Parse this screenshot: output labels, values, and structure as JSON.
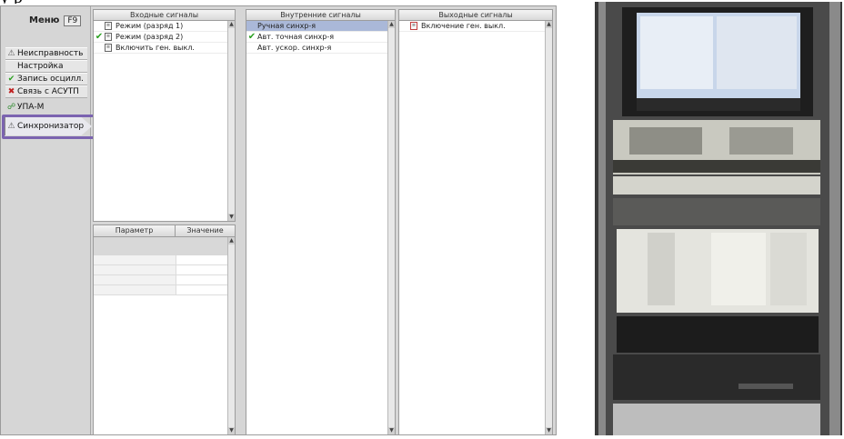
{
  "caption": "у                                                                                           р",
  "menu": {
    "title": "Меню",
    "hotkey": "F9",
    "items": [
      {
        "label": "Неисправность",
        "icon": "warning-icon"
      },
      {
        "label": "Настройка",
        "icon": ""
      },
      {
        "label": "Запись осцилл.",
        "icon": "check-icon"
      },
      {
        "label": "Связь с АСУТП",
        "icon": "error-icon"
      },
      {
        "label": "УПА-М",
        "icon": "network-icon"
      },
      {
        "label": "Синхронизатор",
        "icon": "warning-icon"
      }
    ]
  },
  "panels": {
    "input": {
      "title": "Входные сигналы",
      "rows": [
        {
          "label": "Режим (разряд 1)",
          "checked": false
        },
        {
          "label": "Режим (разряд 2)",
          "checked": true
        },
        {
          "label": "Включить ген. выкл.",
          "checked": false
        }
      ]
    },
    "internal": {
      "title": "Внутренние сигналы",
      "rows": [
        {
          "label": "Ручная синхр-я",
          "checked": false,
          "selected": true
        },
        {
          "label": "Авт. точная синхр-я",
          "checked": true
        },
        {
          "label": "Авт. ускор. синхр-я",
          "checked": false
        }
      ]
    },
    "output": {
      "title": "Выходные сигналы",
      "rows": [
        {
          "label": "Включение ген. выкл.",
          "checked": false
        }
      ]
    }
  },
  "param_table": {
    "columns": [
      "Параметр",
      "Значение"
    ]
  },
  "colors": {
    "selected_row": "#aab8d8",
    "check": "#2aa020",
    "highlight_outline": "#7b63b0"
  }
}
